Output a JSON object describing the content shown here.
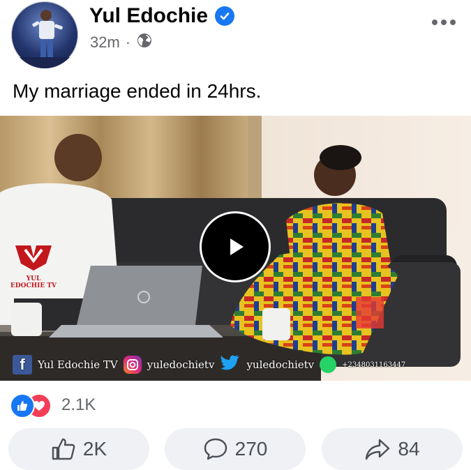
{
  "post": {
    "author": "Yul Edochie",
    "time": "32m",
    "separator": "·",
    "text": "My marriage ended in 24hrs."
  },
  "video": {
    "brand_logo": "YUL EDOCHIE TV",
    "watermark": {
      "facebook": "f",
      "facebook_handle": "Yul Edochie TV",
      "instagram_handle": "yuledochietv",
      "twitter_handle": "yuledochietv",
      "whatsapp": "+2348031163447"
    }
  },
  "reactions": {
    "count": "2.1K",
    "types": [
      "like",
      "love"
    ]
  },
  "actions": {
    "like_count": "2K",
    "comment_count": "270",
    "share_count": "84"
  },
  "colors": {
    "accent": "#1877f2",
    "love": "#f33e58",
    "button_bg": "#eff1f4",
    "secondary_text": "#65676b"
  }
}
